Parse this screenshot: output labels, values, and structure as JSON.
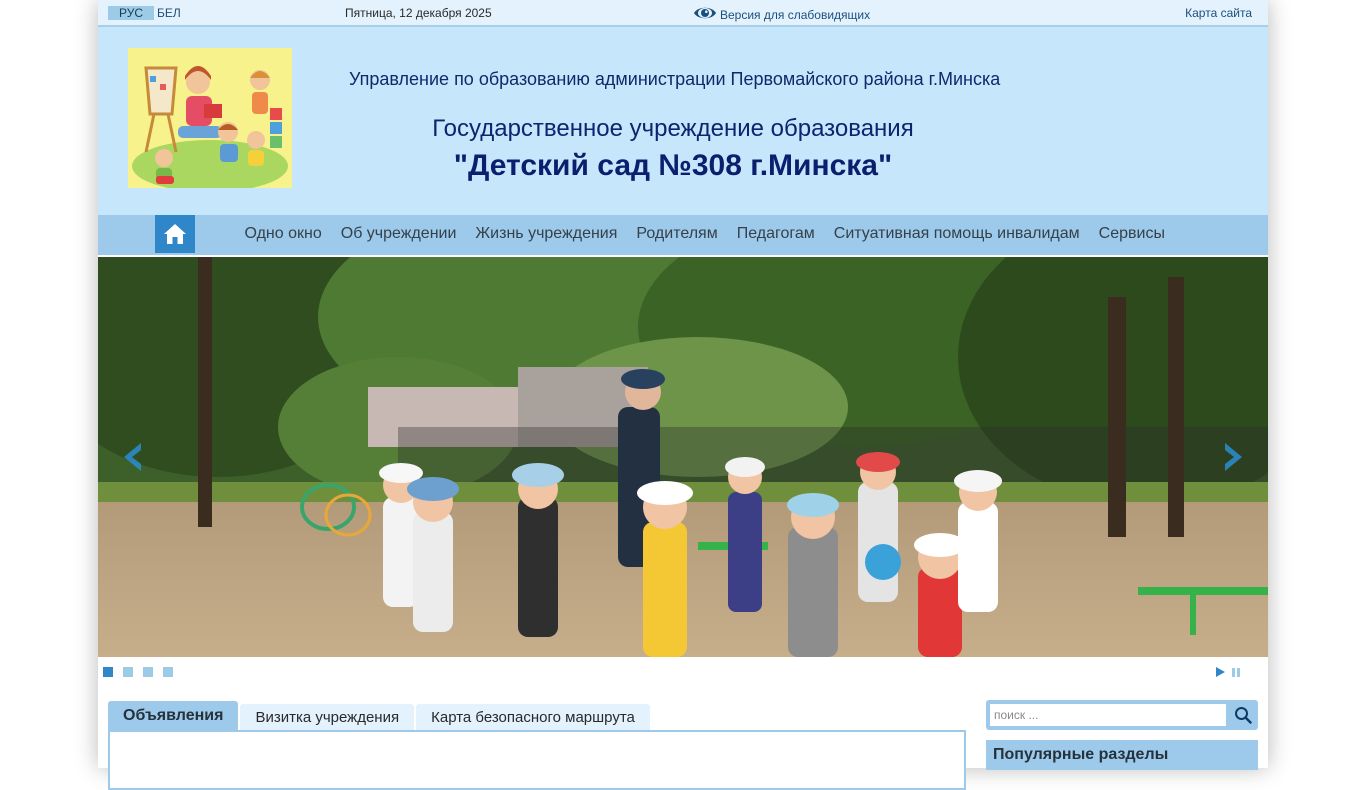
{
  "topbar": {
    "lang_ru": "РУС",
    "lang_by": "БЕЛ",
    "date": "Пятница, 12 декабря 2025",
    "vision_label": "Версия для слабовидящих",
    "vision_icon": "eye-icon",
    "sitemap": "Карта сайта"
  },
  "header": {
    "org": "Управление по образованию администрации Первомайского района г.Минска",
    "institution_type": "Государственное учреждение образования",
    "institution_name": "\"Детский сад №308 г.Минска\""
  },
  "nav": {
    "home_icon": "home-icon",
    "items": [
      "Одно окно",
      "Об учреждении",
      "Жизнь учреждения",
      "Родителям",
      "Педагогам",
      "Ситуативная помощь инвалидам",
      "Сервисы"
    ]
  },
  "slider": {
    "slide_count": 4,
    "active_slide": 1,
    "prev_icon": "chevron-left-icon",
    "next_icon": "chevron-right-icon",
    "play_icon": "play-icon",
    "pause_icon": "pause-icon"
  },
  "tabs": [
    {
      "label": "Объявления",
      "active": true
    },
    {
      "label": "Визитка учреждения",
      "active": false
    },
    {
      "label": "Карта безопасного маршрута",
      "active": false
    }
  ],
  "sidebar": {
    "search_placeholder": "поиск ...",
    "search_icon": "search-icon",
    "popular_title": "Популярные разделы"
  },
  "colors": {
    "header_bg": "#c6e6fc",
    "nav_bg": "#9dcaeb",
    "accent": "#2f86c9",
    "title_text": "#0b1f6e"
  }
}
